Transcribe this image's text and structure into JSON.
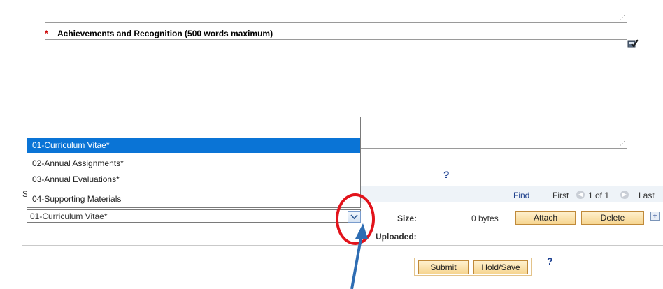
{
  "form": {
    "required_mark": "*",
    "achievements_label": "Achievements and Recognition (500 words maximum)",
    "spellcheck_icon": "spellcheck-icon",
    "help_mark": "?"
  },
  "attachments": {
    "nav": {
      "find": "Find",
      "first": "First",
      "count": "1 of 1",
      "last": "Last"
    },
    "grid_title_fragment": "S",
    "select_value": "01-Curriculum Vitae*",
    "dropdown_options": [
      "",
      "01-Curriculum Vitae*",
      "02-Annual Assignments*",
      "03-Annual Evaluations*",
      "04-Supporting Materials"
    ],
    "size_label": "Size:",
    "size_value": "0 bytes",
    "uploaded_label": "Uploaded:",
    "attach_label": "Attach",
    "delete_label": "Delete",
    "add_row": "+"
  },
  "actions": {
    "submit_label": "Submit",
    "hold_label": "Hold/Save",
    "help_mark": "?"
  },
  "annotation": {
    "circle_color": "#e2131b",
    "arrow_color": "#2e6db3"
  }
}
